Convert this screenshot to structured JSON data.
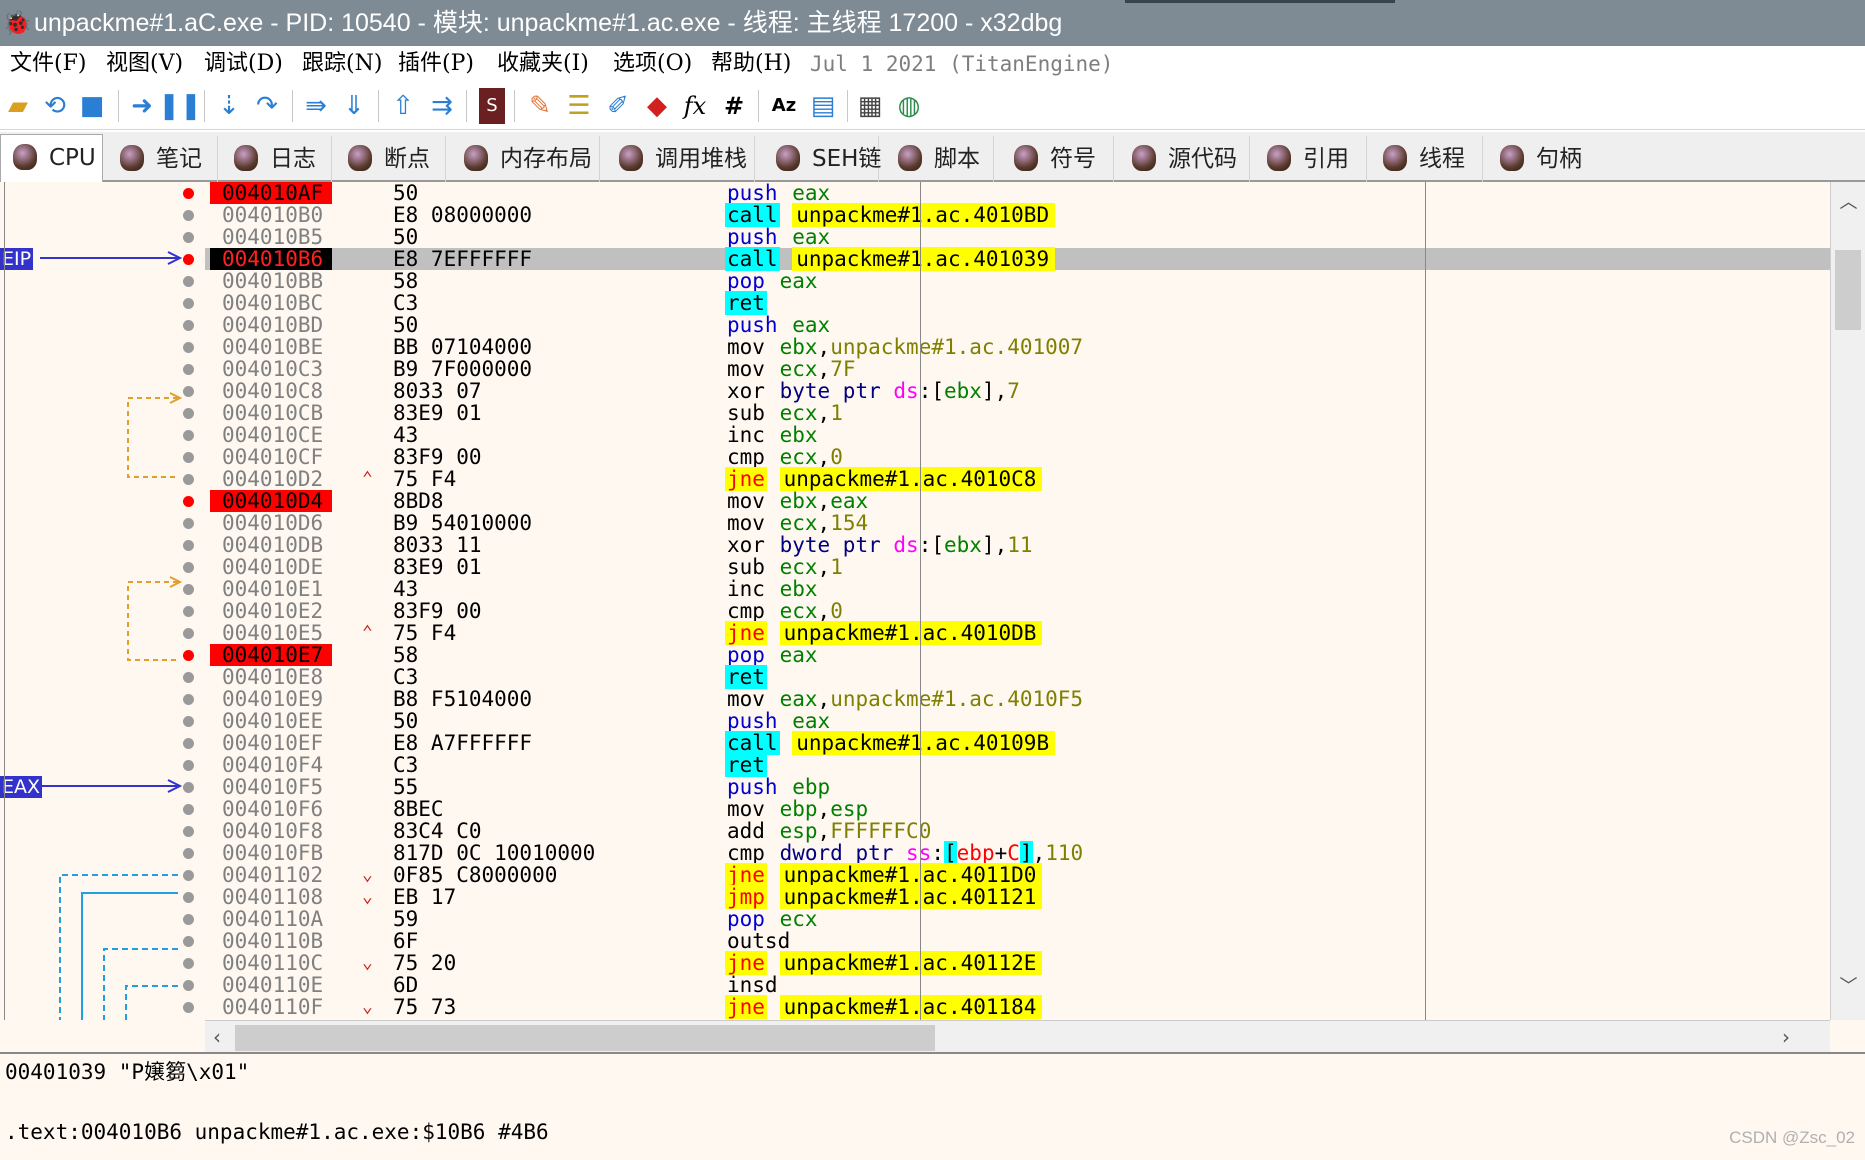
{
  "window": {
    "title": "unpackme#1.aC.exe - PID: 10540 - 模块: unpackme#1.ac.exe - 线程: 主线程 17200 - x32dbg"
  },
  "menu": {
    "items": [
      "文件(F)",
      "视图(V)",
      "调试(D)",
      "跟踪(N)",
      "插件(P)",
      "收藏夹(I)",
      "选项(O)",
      "帮助(H)"
    ],
    "version": "Jul 1 2021 (TitanEngine)"
  },
  "toolbar": {
    "icons": [
      "open-icon",
      "restart-icon",
      "stop-icon",
      "run-icon",
      "pause-icon",
      "step-into-icon",
      "step-over-icon",
      "trace-into-icon",
      "trace-over-icon",
      "execute-till-return-icon",
      "run-to-user-code-icon",
      "scylla-icon",
      "patch-icon",
      "comments-icon",
      "labels-icon",
      "bookmarks-icon",
      "functions-icon",
      "hash-icon",
      "strings-icon",
      "memory-map-icon",
      "calculator-icon",
      "globe-icon"
    ],
    "fx": "fx",
    "hash": "#"
  },
  "tabs": [
    {
      "label": "CPU"
    },
    {
      "label": "笔记"
    },
    {
      "label": "日志"
    },
    {
      "label": "断点"
    },
    {
      "label": "内存布局"
    },
    {
      "label": "调用堆栈"
    },
    {
      "label": "SEH链"
    },
    {
      "label": "脚本"
    },
    {
      "label": "符号"
    },
    {
      "label": "源代码"
    },
    {
      "label": "引用"
    },
    {
      "label": "线程"
    },
    {
      "label": "句柄"
    }
  ],
  "gutter_labels": {
    "eip": "EIP",
    "eax": "EAX"
  },
  "disasm": [
    {
      "addr": "004010AF",
      "bytes": "50",
      "mnem": "push",
      "ops": "eax",
      "style": "push",
      "bp": true,
      "mark": ""
    },
    {
      "addr": "004010B0",
      "bytes": "E8 08000000",
      "mnem": "call",
      "ops": "unpackme#1.ac.4010BD",
      "style": "call",
      "bp": false,
      "mark": ""
    },
    {
      "addr": "004010B5",
      "bytes": "50",
      "mnem": "push",
      "ops": "eax",
      "style": "push",
      "bp": false,
      "mark": ""
    },
    {
      "addr": "004010B6",
      "bytes": "E8 7EFFFFFF",
      "mnem": "call",
      "ops": "unpackme#1.ac.401039",
      "style": "call",
      "bp": true,
      "mark": "",
      "eip": true
    },
    {
      "addr": "004010BB",
      "bytes": "58",
      "mnem": "pop",
      "ops": "eax",
      "style": "push",
      "bp": false,
      "mark": ""
    },
    {
      "addr": "004010BC",
      "bytes": "C3",
      "mnem": "ret",
      "ops": "",
      "style": "ret",
      "bp": false,
      "mark": ""
    },
    {
      "addr": "004010BD",
      "bytes": "50",
      "mnem": "push",
      "ops": "eax",
      "style": "push",
      "bp": false,
      "mark": ""
    },
    {
      "addr": "004010BE",
      "bytes": "BB 07104000",
      "mnem": "mov",
      "ops": "ebx,unpackme#1.ac.401007",
      "style": "plain",
      "bp": false,
      "mark": ""
    },
    {
      "addr": "004010C3",
      "bytes": "B9 7F000000",
      "mnem": "mov",
      "ops": "ecx,7F",
      "style": "plain",
      "bp": false,
      "mark": ""
    },
    {
      "addr": "004010C8",
      "bytes": "8033 07",
      "mnem": "xor",
      "ops": "byte ptr ds:[ebx],7",
      "style": "plain",
      "bp": false,
      "mark": ""
    },
    {
      "addr": "004010CB",
      "bytes": "83E9 01",
      "mnem": "sub",
      "ops": "ecx,1",
      "style": "plain",
      "bp": false,
      "mark": ""
    },
    {
      "addr": "004010CE",
      "bytes": "43",
      "mnem": "inc",
      "ops": "ebx",
      "style": "plain",
      "bp": false,
      "mark": ""
    },
    {
      "addr": "004010CF",
      "bytes": "83F9 00",
      "mnem": "cmp",
      "ops": "ecx,0",
      "style": "plain",
      "bp": false,
      "mark": ""
    },
    {
      "addr": "004010D2",
      "bytes": "75 F4",
      "mnem": "jne",
      "ops": "unpackme#1.ac.4010C8",
      "style": "jcc",
      "bp": false,
      "mark": "^"
    },
    {
      "addr": "004010D4",
      "bytes": "8BD8",
      "mnem": "mov",
      "ops": "ebx,eax",
      "style": "plain",
      "bp": true,
      "mark": ""
    },
    {
      "addr": "004010D6",
      "bytes": "B9 54010000",
      "mnem": "mov",
      "ops": "ecx,154",
      "style": "plain",
      "bp": false,
      "mark": ""
    },
    {
      "addr": "004010DB",
      "bytes": "8033 11",
      "mnem": "xor",
      "ops": "byte ptr ds:[ebx],11",
      "style": "plain",
      "bp": false,
      "mark": ""
    },
    {
      "addr": "004010DE",
      "bytes": "83E9 01",
      "mnem": "sub",
      "ops": "ecx,1",
      "style": "plain",
      "bp": false,
      "mark": ""
    },
    {
      "addr": "004010E1",
      "bytes": "43",
      "mnem": "inc",
      "ops": "ebx",
      "style": "plain",
      "bp": false,
      "mark": ""
    },
    {
      "addr": "004010E2",
      "bytes": "83F9 00",
      "mnem": "cmp",
      "ops": "ecx,0",
      "style": "plain",
      "bp": false,
      "mark": ""
    },
    {
      "addr": "004010E5",
      "bytes": "75 F4",
      "mnem": "jne",
      "ops": "unpackme#1.ac.4010DB",
      "style": "jcc",
      "bp": false,
      "mark": "^"
    },
    {
      "addr": "004010E7",
      "bytes": "58",
      "mnem": "pop",
      "ops": "eax",
      "style": "push",
      "bp": true,
      "mark": ""
    },
    {
      "addr": "004010E8",
      "bytes": "C3",
      "mnem": "ret",
      "ops": "",
      "style": "ret",
      "bp": false,
      "mark": ""
    },
    {
      "addr": "004010E9",
      "bytes": "B8 F5104000",
      "mnem": "mov",
      "ops": "eax,unpackme#1.ac.4010F5",
      "style": "plain",
      "bp": false,
      "mark": ""
    },
    {
      "addr": "004010EE",
      "bytes": "50",
      "mnem": "push",
      "ops": "eax",
      "style": "push",
      "bp": false,
      "mark": ""
    },
    {
      "addr": "004010EF",
      "bytes": "E8 A7FFFFFF",
      "mnem": "call",
      "ops": "unpackme#1.ac.40109B",
      "style": "call",
      "bp": false,
      "mark": ""
    },
    {
      "addr": "004010F4",
      "bytes": "C3",
      "mnem": "ret",
      "ops": "",
      "style": "ret",
      "bp": false,
      "mark": ""
    },
    {
      "addr": "004010F5",
      "bytes": "55",
      "mnem": "push",
      "ops": "ebp",
      "style": "push",
      "bp": false,
      "mark": ""
    },
    {
      "addr": "004010F6",
      "bytes": "8BEC",
      "mnem": "mov",
      "ops": "ebp,esp",
      "style": "plain",
      "bp": false,
      "mark": ""
    },
    {
      "addr": "004010F8",
      "bytes": "83C4 C0",
      "mnem": "add",
      "ops": "esp,FFFFFFC0",
      "style": "plain",
      "bp": false,
      "mark": ""
    },
    {
      "addr": "004010FB",
      "bytes": "817D 0C 10010000",
      "mnem": "cmp",
      "ops": "dword ptr ss:[ebp+C],110",
      "style": "plain",
      "bp": false,
      "mark": ""
    },
    {
      "addr": "00401102",
      "bytes": "0F85 C8000000",
      "mnem": "jne",
      "ops": "unpackme#1.ac.4011D0",
      "style": "jcc",
      "bp": false,
      "mark": "v"
    },
    {
      "addr": "00401108",
      "bytes": "EB 17",
      "mnem": "jmp",
      "ops": "unpackme#1.ac.401121",
      "style": "jcc",
      "bp": false,
      "mark": "v"
    },
    {
      "addr": "0040110A",
      "bytes": "59",
      "mnem": "pop",
      "ops": "ecx",
      "style": "push",
      "bp": false,
      "mark": ""
    },
    {
      "addr": "0040110B",
      "bytes": "6F",
      "mnem": "outsd",
      "ops": "",
      "style": "plain",
      "bp": false,
      "mark": ""
    },
    {
      "addr": "0040110C",
      "bytes": "75 20",
      "mnem": "jne",
      "ops": "unpackme#1.ac.40112E",
      "style": "jcc",
      "bp": false,
      "mark": "v"
    },
    {
      "addr": "0040110E",
      "bytes": "6D",
      "mnem": "insd",
      "ops": "",
      "style": "plain",
      "bp": false,
      "mark": ""
    },
    {
      "addr": "0040110F",
      "bytes": "75 73",
      "mnem": "jne",
      "ops": "unpackme#1.ac.401184",
      "style": "jcc",
      "bp": false,
      "mark": "v"
    }
  ],
  "info": {
    "line1": "00401039 \"P嬢篘\\x01\"",
    "line2": ".text:004010B6 unpackme#1.ac.exe:$10B6 #4B6"
  },
  "watermark": "CSDN @Zsc_02",
  "colors": {
    "breakpoint": "#ff0000",
    "call_ret_bg": "#00ffff",
    "jump_bg": "#ffff00",
    "register": "#008000",
    "immediate": "#808000",
    "segment": "#ff00ff",
    "current_line": "#c0c0c0",
    "label_bg": "#3333cc"
  }
}
